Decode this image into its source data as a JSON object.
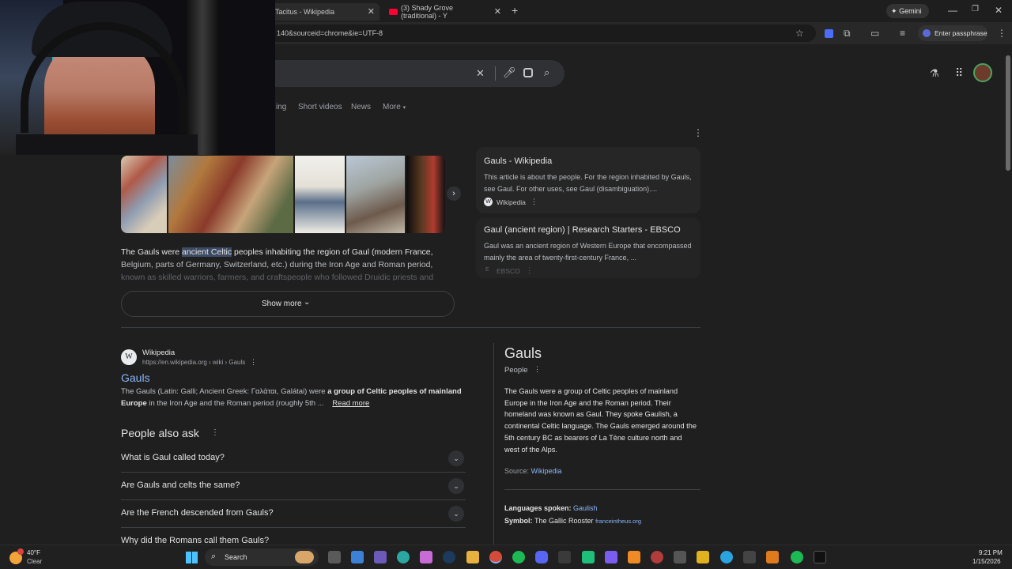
{
  "browser": {
    "tabs": [
      {
        "label": "Tacitus - Wikipedia"
      },
      {
        "label": "(3) Shady Grove (traditional) - Y"
      }
    ],
    "new_tab": "+",
    "gemini_label": "Gemini",
    "url_fragment": "140&sourceid=chrome&ie=UTF-8",
    "passphrase_label": "Enter passphrase"
  },
  "search": {
    "nav_tabs": [
      "ing",
      "Short videos",
      "News",
      "More"
    ]
  },
  "featured": {
    "snippet_pre": "The Gauls were ",
    "snippet_highlight": "ancient Celtic",
    "snippet_post": " peoples inhabiting the region of Gaul (modern France,",
    "snippet_line2": "Belgium, parts of Germany, Switzerland, etc.) during the Iron Age and Roman period,",
    "snippet_line3": "known as skilled warriors, farmers, and craftspeople who followed Druidic priests and",
    "show_more": "Show more",
    "sources": [
      {
        "title": "Gauls - Wikipedia",
        "text": "This article is about the people. For the region inhabited by Gauls, see Gaul. For other uses, see Gaul (disambiguation)....",
        "site": "Wikipedia"
      },
      {
        "title": "Gaul (ancient region) | Research Starters - EBSCO",
        "text": "Gaul was an ancient region of Western Europe that encompassed mainly the area of twenty-first-century France, ...",
        "site": "EBSCO"
      }
    ]
  },
  "result": {
    "site": "Wikipedia",
    "url": "https://en.wikipedia.org › wiki › Gauls",
    "title": "Gauls",
    "snippet_a": "The Gauls (Latin: Galli; Ancient Greek: Γαλάται, Galátai) were ",
    "snippet_bold": "a group of Celtic peoples of mainland",
    "snippet_line2_bold": "Europe",
    "snippet_line2": " in the Iron Age and the Roman period (roughly 5th ...",
    "read_more": "Read more"
  },
  "paa": {
    "heading": "People also ask",
    "questions": [
      "What is Gaul called today?",
      "Are Gauls and celts the same?",
      "Are the French descended from Gauls?",
      "Why did the Romans call them Gauls?"
    ]
  },
  "knowledge": {
    "title": "Gauls",
    "subtitle": "People",
    "lines": [
      "The Gauls were a group of Celtic peoples of mainland",
      "Europe in the Iron Age and the Roman period. Their",
      "homeland was known as Gaul. They spoke Gaulish, a",
      "continental Celtic language. The Gauls emerged around the",
      "5th century BC as bearers of La Tène culture north and",
      "west of the Alps."
    ],
    "source_label": "Source: ",
    "source_link": "Wikipedia",
    "languages_label": "Languages spoken: ",
    "languages_value": "Gaulish",
    "symbol_label": "Symbol: ",
    "symbol_value": "The Gallic Rooster",
    "symbol_link": "franceintheus.org"
  },
  "taskbar": {
    "weather_temp": "40°F",
    "weather_desc": "Clear",
    "search_label": "Search",
    "time": "9:21 PM",
    "date": "1/15/2026"
  },
  "colors": {
    "accent_blue": "#8ab4f8",
    "bg": "#1f1f1f",
    "highlight": "#3c4a63"
  }
}
